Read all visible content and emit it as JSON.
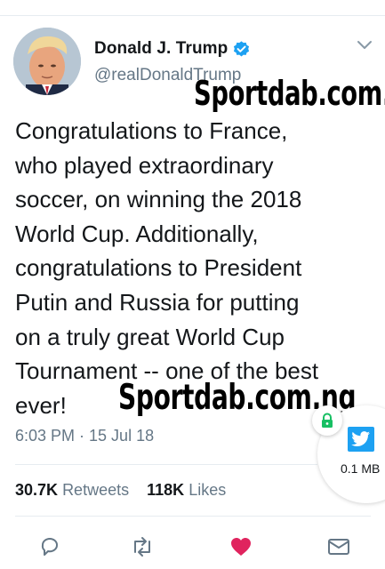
{
  "tweet": {
    "author": {
      "display_name": "Donald J. Trump",
      "handle": "@realDonaldTrump",
      "verified": true
    },
    "text": "Congratulations to France,\nwho played extraordinary\nsoccer, on winning the 2018\nWorld Cup. Additionally,\ncongratulations to President\nPutin and Russia for putting\non a truly great World Cup\nTournament -- one of the best\never!",
    "timestamp": "6:03 PM · 15 Jul 18",
    "stats": {
      "retweets_count": "30.7K",
      "retweets_label": "Retweets",
      "likes_count": "118K",
      "likes_label": "Likes"
    },
    "actions": {
      "reply_icon": "reply-icon",
      "retweet_icon": "retweet-icon",
      "like_icon": "heart-icon",
      "dm_icon": "envelope-icon"
    },
    "liked": true
  },
  "watermarks": [
    "Sportdab.com.ng",
    "Sportdab.com.ng"
  ],
  "data_widget": {
    "size_label": "0.1 MB",
    "app_icon": "twitter-logo-icon",
    "lock_icon": "lock-icon"
  },
  "colors": {
    "verified_blue": "#1da1f2",
    "secondary_text": "#657786",
    "like_red": "#e0245e",
    "lock_green": "#17bf63"
  }
}
